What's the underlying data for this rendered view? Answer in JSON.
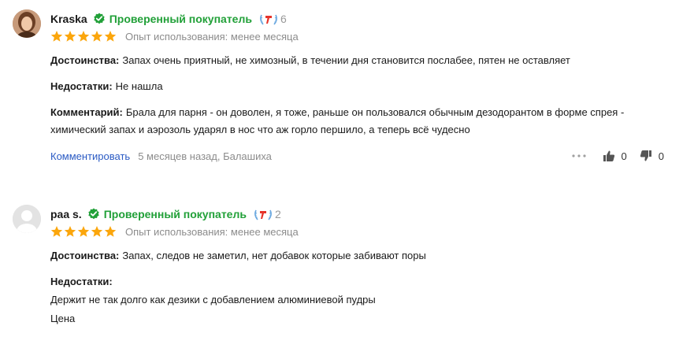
{
  "reviews": [
    {
      "author": "Kraska",
      "verified_label": "Проверенный покупатель",
      "award_count": "6",
      "rating": 5,
      "experience": "Опыт использования: менее месяца",
      "pros_label": "Достоинства:",
      "pros_text": "Запах очень приятный, не химозный, в течении дня становится послабее, пятен не оставляет",
      "cons_label": "Недостатки:",
      "cons_text": "Не нашла",
      "comment_label": "Комментарий:",
      "comment_line1": "Брала для парня - он доволен, я тоже, раньше он пользовался обычным дезодорантом в форме спрея -",
      "comment_line2": "химический запах и аэрозоль ударял в нос что аж горло першило, а теперь всё чудесно",
      "comment_link": "Комментировать",
      "meta": "5 месяцев назад, Балашиха",
      "likes": "0",
      "dislikes": "0"
    },
    {
      "author": "paa s.",
      "verified_label": "Проверенный покупатель",
      "award_count": "2",
      "rating": 5,
      "experience": "Опыт использования: менее месяца",
      "pros_label": "Достоинства:",
      "pros_text": "Запах, следов не заметил, нет добавок которые забивают поры",
      "cons_label": "Недостатки:",
      "cons_line1": "Держит не так долго как дезики с добавлением алюминиевой пудры",
      "cons_line2": "Цена"
    }
  ],
  "colors": {
    "verified": "#21a038",
    "star": "#fba60c",
    "link": "#2b5bc4",
    "muted": "#8c8c8c",
    "award_red": "#e6332a",
    "award_blue": "#6aa8e0"
  },
  "icons": [
    "verified-check-icon",
    "award-laurel-icon",
    "star-icon",
    "more-dots-icon",
    "thumbs-up-icon",
    "thumbs-down-icon"
  ]
}
